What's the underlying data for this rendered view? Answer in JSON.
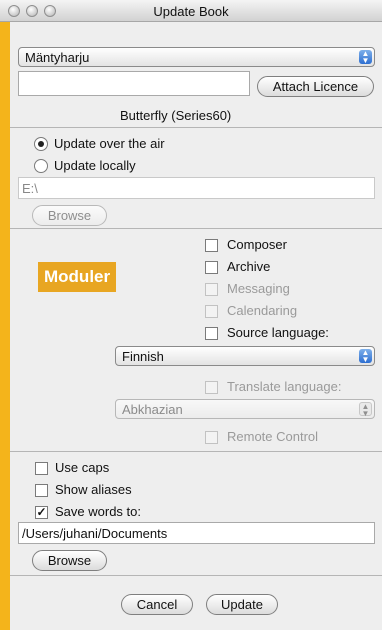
{
  "window": {
    "title": "Update Book"
  },
  "top_popup": {
    "value": "Mäntyharju"
  },
  "licence_field": {
    "value": ""
  },
  "attach_licence_button": {
    "label": "Attach Licence"
  },
  "device_label": "Butterfly (Series60)",
  "update_mode": {
    "over_air": {
      "label": "Update over the air",
      "selected": true
    },
    "locally": {
      "label": "Update locally",
      "selected": false
    }
  },
  "path_field": {
    "value": "E:\\"
  },
  "browse_button_top": {
    "label": "Browse"
  },
  "modules_badge": "Moduler",
  "modules": {
    "composer": {
      "label": "Composer",
      "checked": false,
      "enabled": true
    },
    "archive": {
      "label": "Archive",
      "checked": false,
      "enabled": true
    },
    "messaging": {
      "label": "Messaging",
      "checked": false,
      "enabled": false
    },
    "calendaring": {
      "label": "Calendaring",
      "checked": false,
      "enabled": false
    },
    "source_language": {
      "label": "Source language:",
      "checked": false,
      "enabled": true
    }
  },
  "source_language_popup": {
    "value": "Finnish"
  },
  "translate_language": {
    "label": "Translate language:",
    "checked": false,
    "enabled": false
  },
  "translate_language_popup": {
    "value": "Abkhazian"
  },
  "remote_control": {
    "label": "Remote Control",
    "checked": false,
    "enabled": false
  },
  "options": {
    "use_caps": {
      "label": "Use caps",
      "checked": false
    },
    "show_aliases": {
      "label": "Show aliases",
      "checked": false
    },
    "save_words": {
      "label": "Save words to:",
      "checked": true
    }
  },
  "save_path_field": {
    "value": "/Users/juhani/Documents"
  },
  "browse_button_bottom": {
    "label": "Browse"
  },
  "cancel_button": {
    "label": "Cancel"
  },
  "update_button": {
    "label": "Update"
  },
  "icons": [
    "close-icon",
    "minimize-icon",
    "zoom-icon",
    "popup-arrows-icon",
    "checkmark-icon"
  ]
}
